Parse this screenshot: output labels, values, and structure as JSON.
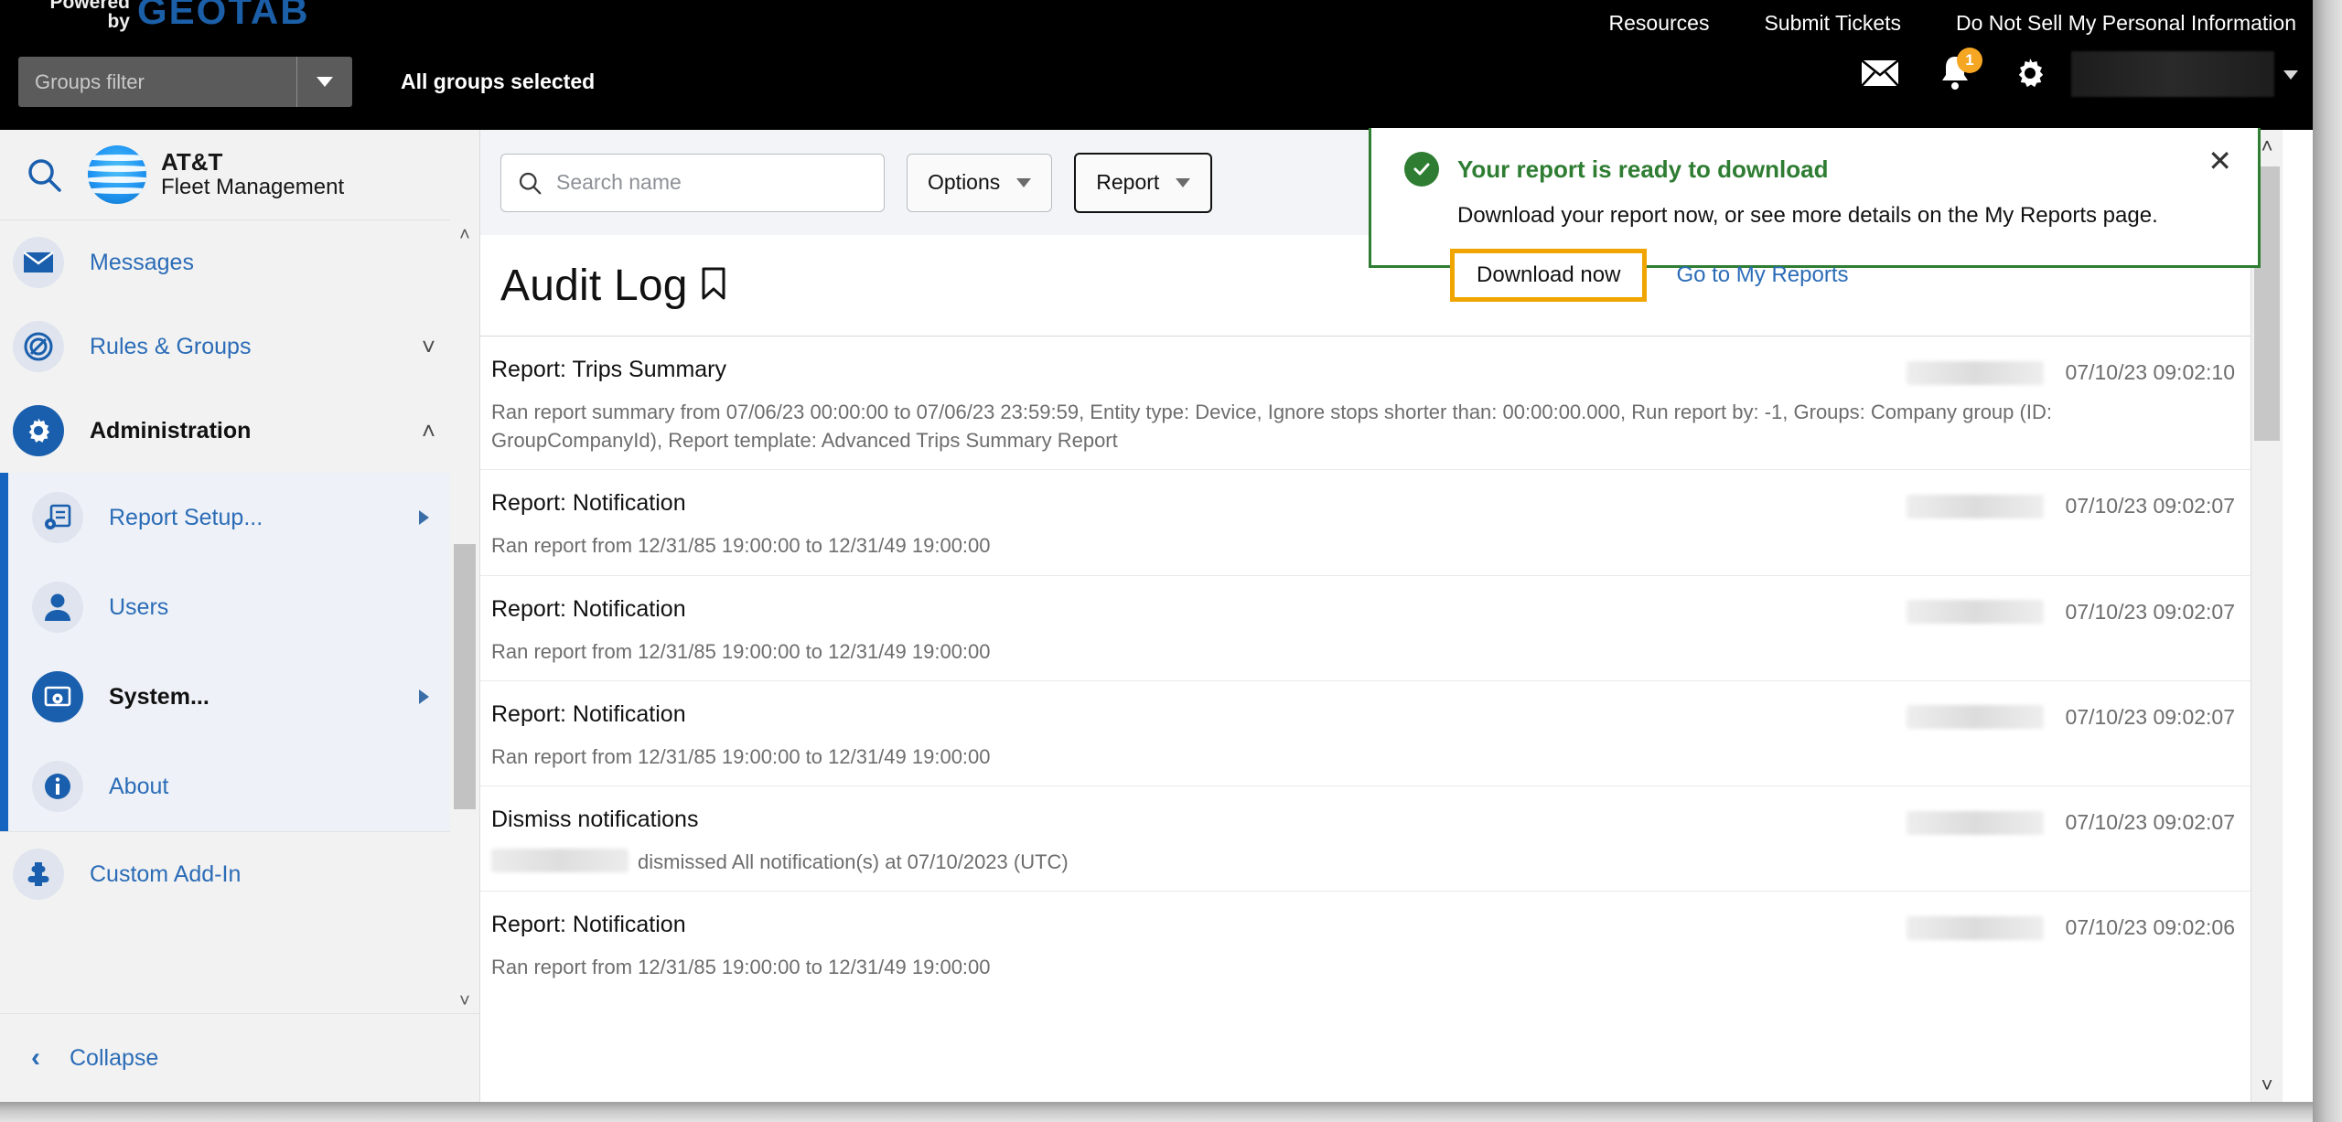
{
  "topbar": {
    "powered_line1": "Powered",
    "powered_line2": "by",
    "brand": "GEOTAB",
    "links": [
      {
        "label": "Resources"
      },
      {
        "label": "Submit Tickets"
      },
      {
        "label": "Do Not Sell My Personal Information"
      }
    ],
    "groups_filter_placeholder": "Groups filter",
    "groups_status": "All groups selected",
    "notification_badge": "1",
    "icons": [
      "mail-icon",
      "bell-icon",
      "gear-icon",
      "user-icon"
    ]
  },
  "sidebar": {
    "product_line1": "AT&T",
    "product_line2": "Fleet Management",
    "items": [
      {
        "label": "Messages",
        "icon": "mail-icon",
        "expander": "",
        "active": false
      },
      {
        "label": "Rules & Groups",
        "icon": "rules-icon",
        "expander": "chevron-down-icon",
        "active": false
      },
      {
        "label": "Administration",
        "icon": "gear-icon",
        "expander": "chevron-up-icon",
        "active": true
      }
    ],
    "submenu": [
      {
        "label": "Report Setup...",
        "icon": "report-setup-icon",
        "arrow": "caret-right-icon",
        "active": false
      },
      {
        "label": "Users",
        "icon": "user-icon",
        "arrow": "",
        "active": false
      },
      {
        "label": "System...",
        "icon": "system-icon",
        "arrow": "caret-right-icon",
        "active": true
      },
      {
        "label": "About",
        "icon": "info-icon",
        "arrow": "",
        "active": false
      }
    ],
    "addin": {
      "label": "Custom Add-In",
      "icon": "puzzle-icon"
    },
    "collapse": {
      "label": "Collapse",
      "icon": "chevron-left-icon"
    }
  },
  "toolbar": {
    "search_placeholder": "Search name",
    "options_label": "Options",
    "report_label": "Report"
  },
  "page": {
    "title": "Audit Log",
    "bookmark_icon": "bookmark-icon"
  },
  "log_rows": [
    {
      "title": "Report: Trips Summary",
      "description": "Ran report summary from 07/06/23 00:00:00 to 07/06/23 23:59:59, Entity type: Device, Ignore stops shorter than: 00:00:00.000, Run report by: -1, Groups: Company group (ID: GroupCompanyId), Report template: Advanced Trips Summary Report",
      "timestamp": "07/10/23 09:02:10",
      "user_redacted": true,
      "desc_redacted": false
    },
    {
      "title": "Report: Notification",
      "description": "Ran report from 12/31/85 19:00:00 to 12/31/49 19:00:00",
      "timestamp": "07/10/23 09:02:07",
      "user_redacted": true,
      "desc_redacted": false
    },
    {
      "title": "Report: Notification",
      "description": "Ran report from 12/31/85 19:00:00 to 12/31/49 19:00:00",
      "timestamp": "07/10/23 09:02:07",
      "user_redacted": true,
      "desc_redacted": false
    },
    {
      "title": "Report: Notification",
      "description": "Ran report from 12/31/85 19:00:00 to 12/31/49 19:00:00",
      "timestamp": "07/10/23 09:02:07",
      "user_redacted": true,
      "desc_redacted": false
    },
    {
      "title": "Dismiss notifications",
      "description": "dismissed All notification(s) at 07/10/2023 (UTC)",
      "timestamp": "07/10/23 09:02:07",
      "user_redacted": true,
      "desc_redacted": true
    },
    {
      "title": "Report: Notification",
      "description": "Ran report from 12/31/85 19:00:00 to 12/31/49 19:00:00",
      "timestamp": "07/10/23 09:02:06",
      "user_redacted": true,
      "desc_redacted": false
    }
  ],
  "toast": {
    "title": "Your report is ready to download",
    "message": "Download your report now, or see more details on the My Reports page.",
    "primary_label": "Download now",
    "link_label": "Go to My Reports",
    "close_icon": "close-icon",
    "status_icon": "check-circle-icon",
    "accent_color": "#2e7d32",
    "button_outline_color": "#f0a500"
  }
}
